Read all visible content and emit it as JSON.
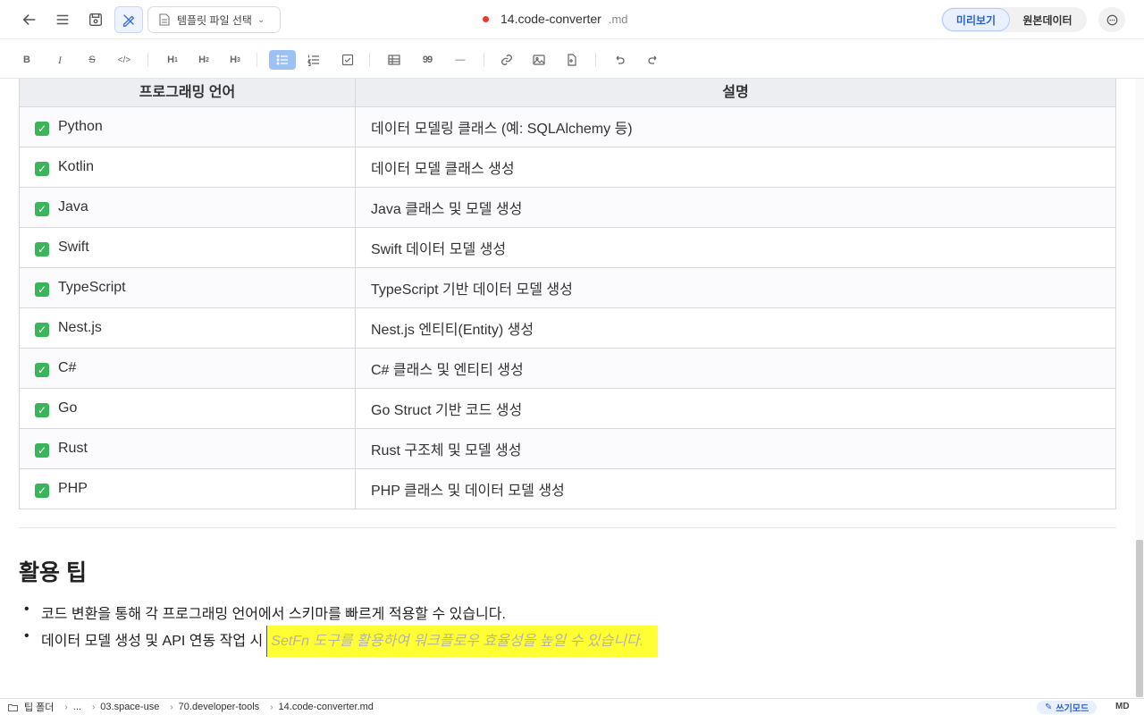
{
  "header": {
    "template_select": "템플릿 파일 선택",
    "filename": "14.code-converter",
    "extension": ".md",
    "unsaved_color": "#e53935",
    "view_tabs": [
      {
        "label": "미리보기",
        "active": true
      },
      {
        "label": "원본데이터",
        "active": false
      }
    ]
  },
  "toolbar": {
    "bold": "B",
    "italic": "I",
    "strike": "S",
    "code": "</>",
    "h1": "H",
    "h2": "H",
    "h3": "H",
    "h1_sub": "1",
    "h2_sub": "2",
    "h3_sub": "3",
    "quote": "99",
    "hr": "—"
  },
  "table": {
    "headers": [
      "프로그래밍 언어",
      "설명"
    ],
    "rows": [
      {
        "lang": "Python",
        "desc": "데이터 모델링 클래스 (예: SQLAlchemy 등)"
      },
      {
        "lang": "Kotlin",
        "desc": "데이터 모델 클래스 생성"
      },
      {
        "lang": "Java",
        "desc": "Java 클래스 및 모델 생성"
      },
      {
        "lang": "Swift",
        "desc": "Swift 데이터 모델 생성"
      },
      {
        "lang": "TypeScript",
        "desc": "TypeScript 기반 데이터 모델 생성"
      },
      {
        "lang": "Nest.js",
        "desc": "Nest.js 엔티티(Entity) 생성"
      },
      {
        "lang": "C#",
        "desc": "C# 클래스 및 엔티티 생성"
      },
      {
        "lang": "Go",
        "desc": "Go Struct 기반 코드 생성"
      },
      {
        "lang": "Rust",
        "desc": "Rust 구조체 및 모델 생성"
      },
      {
        "lang": "PHP",
        "desc": "PHP 클래스 및 데이터 모델 생성"
      }
    ],
    "check_glyph": "✓"
  },
  "section": {
    "heading": "활용 팁",
    "bullets": [
      "코드 변환을 통해 각 프로그래밍 언어에서 스키마를 빠르게 적용할 수 있습니다.",
      "데이터 모델 생성 및 API 연동 작업 시"
    ],
    "highlight_suggestion": "SetFn 도구를 활용하여 워크플로우 효율성을 높일 수 있습니다.",
    "highlight_color": "#ffff33"
  },
  "statusbar": {
    "breadcrumb": [
      "팁 폴더",
      "...",
      "03.space-use",
      "70.developer-tools",
      "14.code-converter.md"
    ],
    "mode": "쓰기모드",
    "format": "MD"
  }
}
